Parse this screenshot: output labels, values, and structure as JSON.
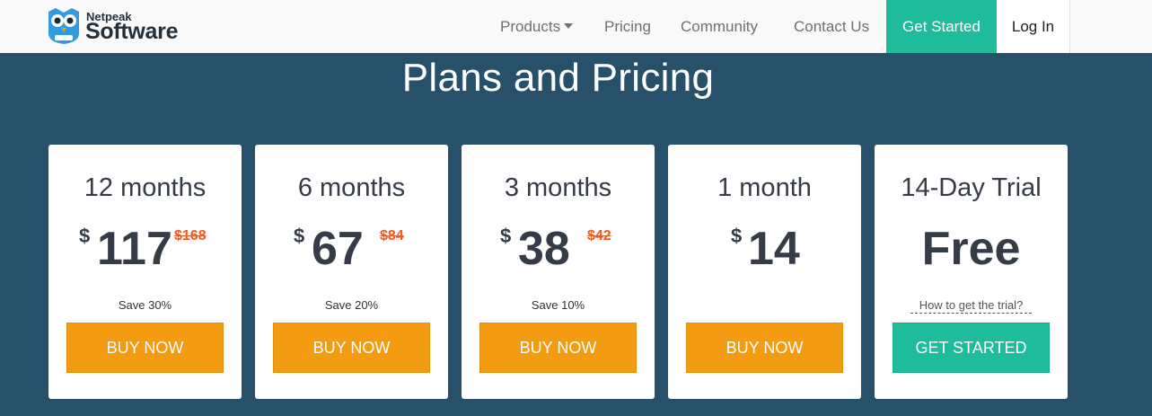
{
  "header": {
    "logo_line1": "Netpeak",
    "logo_line2": "Software",
    "nav": {
      "products": "Products",
      "pricing": "Pricing",
      "community": "Community",
      "contact": "Contact Us"
    },
    "get_started": "Get Started",
    "login": "Log In"
  },
  "page_title": "Plans and Pricing",
  "plans": [
    {
      "period": "12 months",
      "currency": "$",
      "price": "117",
      "old_price": "$168",
      "save": "Save 30%",
      "cta": "BUY NOW"
    },
    {
      "period": "6 months",
      "currency": "$",
      "price": "67",
      "old_price": "$84",
      "save": "Save 20%",
      "cta": "BUY NOW"
    },
    {
      "period": "3 months",
      "currency": "$",
      "price": "38",
      "old_price": "$42",
      "save": "Save 10%",
      "cta": "BUY NOW"
    },
    {
      "period": "1 month",
      "currency": "$",
      "price": "14",
      "cta": "BUY NOW"
    },
    {
      "period": "14-Day Trial",
      "price": "Free",
      "trial_link": "How to get the trial?",
      "cta": "GET STARTED"
    }
  ],
  "colors": {
    "background": "#27506b",
    "accent_green": "#1fbc9c",
    "buy_orange": "#f39c12",
    "old_price_red": "#f05a24",
    "text_dark": "#353c47"
  },
  "icons": {
    "logo": "owl-logo-icon",
    "products_dropdown": "caret-down-icon"
  }
}
